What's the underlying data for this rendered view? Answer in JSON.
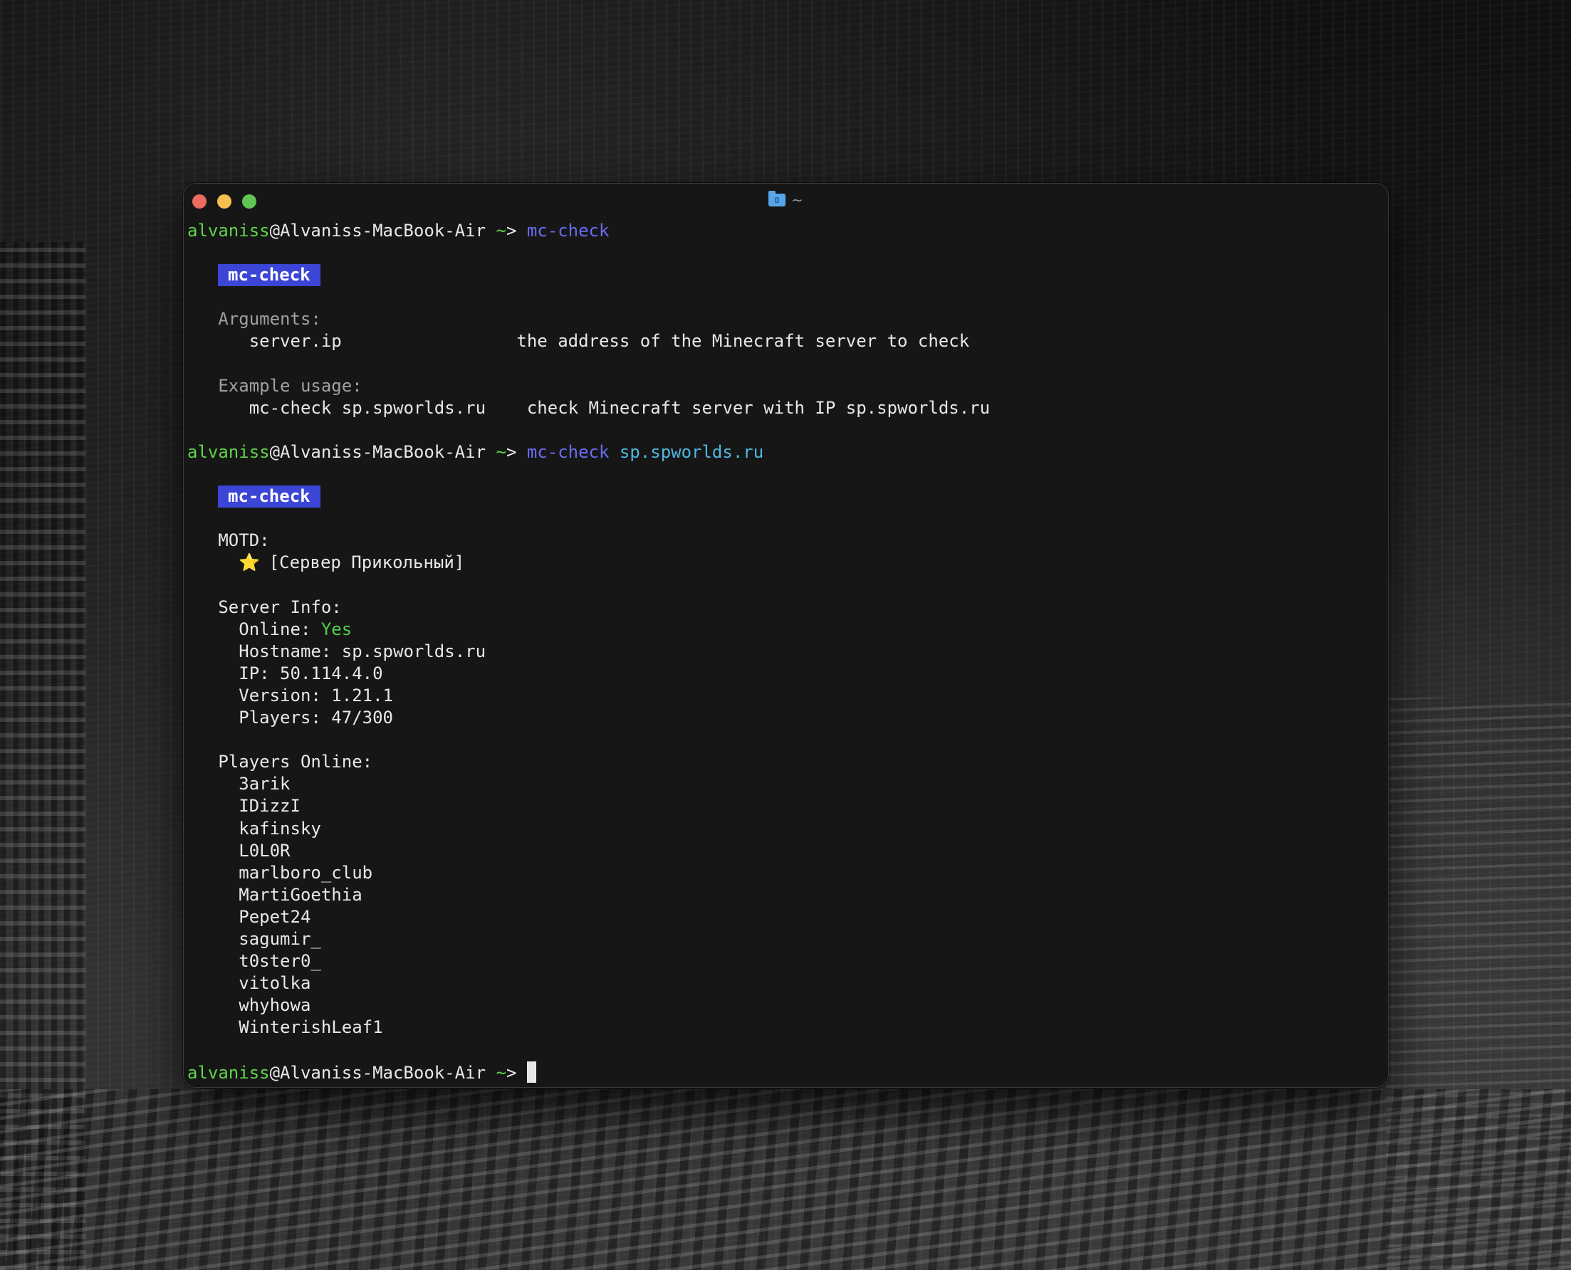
{
  "window": {
    "title": "~",
    "folder_icon": "folder-icon",
    "traffic_colors": {
      "close": "#ed6a5e",
      "minimize": "#f4bf4f",
      "zoom": "#61c554"
    }
  },
  "prompt": {
    "user": "alvaniss",
    "host": "@Alvaniss-MacBook-Air",
    "tilde": "~",
    "arrow": ">"
  },
  "session": {
    "cmd1": "mc-check",
    "help": {
      "badge": "mc-check",
      "arguments_header": "Arguments:",
      "arg_name": "server.ip",
      "arg_desc": "the address of the Minecraft server to check",
      "example_header": "Example usage:",
      "example_cmd": "mc-check sp.spworlds.ru",
      "example_desc": "check Minecraft server with IP sp.spworlds.ru"
    },
    "cmd2": "mc-check",
    "cmd2_arg": "sp.spworlds.ru",
    "result": {
      "badge": "mc-check",
      "motd_header": "MOTD:",
      "motd_star": "⭐",
      "motd_text": "[Сервер Прикольный]",
      "info_header": "Server Info:",
      "online_label": "Online:",
      "online_value": "Yes",
      "hostname": "Hostname: sp.spworlds.ru",
      "ip": "IP: 50.114.4.0",
      "version": "Version: 1.21.1",
      "players": "Players: 47/300",
      "players_header": "Players Online:",
      "players_list": [
        "3arik",
        "IDizzI",
        "kafinsky",
        "L0L0R",
        "marlboro_club",
        "MartiGoethia",
        "Pepet24",
        "sagumir_",
        "t0ster0_",
        "vitolka",
        "whyhowa",
        "WinterishLeaf1"
      ]
    }
  },
  "colors": {
    "prompt_user": "#5fd44a",
    "command": "#6b6cf5",
    "argument": "#4fb8e0",
    "badge_bg": "#3b45d6",
    "online_yes": "#52d14a"
  }
}
